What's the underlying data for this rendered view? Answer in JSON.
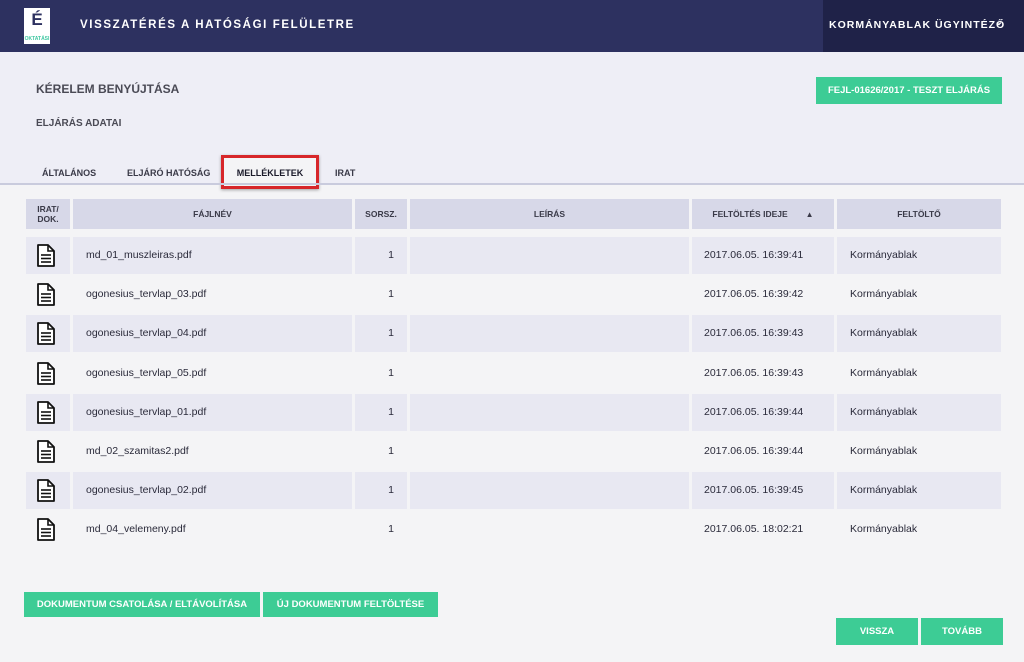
{
  "header": {
    "logo_letter": "É",
    "logo_subtext": "OKTATÁSI",
    "app_title": "VISSZATÉRÉS A HATÓSÁGI FELÜLETRE",
    "user_label": "KORMÁNYABLAK ÜGYINTÉZŐ",
    "user_chevron": "⌄"
  },
  "page": {
    "title": "KÉRELEM BENYÚJTÁSA",
    "subtitle": "ELJÁRÁS ADATAI",
    "case_button": "FEJL-01626/2017 - TESZT ELJÁRÁS"
  },
  "tabs": [
    {
      "label": "ÁLTALÁNOS",
      "active": false
    },
    {
      "label": "ELJÁRÓ HATÓSÁG",
      "active": false
    },
    {
      "label": "MELLÉKLETEK",
      "active": true
    },
    {
      "label": "IRAT",
      "active": false
    }
  ],
  "table": {
    "columns": [
      "IRAT/ DOK.",
      "FÁJLNÉV",
      "SORSZ.",
      "LEÍRÁS",
      "FELTÖLTÉS IDEJE",
      "FELTÖLTŐ"
    ],
    "sort_indicator": "▲",
    "rows": [
      {
        "icon": "document-icon",
        "filename": "md_01_muszleiras.pdf",
        "num": "1",
        "desc": "",
        "time": "2017.06.05. 16:39:41",
        "uploader": "Kormányablak"
      },
      {
        "icon": "document-icon",
        "filename": "ogonesius_tervlap_03.pdf",
        "num": "1",
        "desc": "",
        "time": "2017.06.05. 16:39:42",
        "uploader": "Kormányablak"
      },
      {
        "icon": "document-icon",
        "filename": "ogonesius_tervlap_04.pdf",
        "num": "1",
        "desc": "",
        "time": "2017.06.05. 16:39:43",
        "uploader": "Kormányablak"
      },
      {
        "icon": "document-icon",
        "filename": "ogonesius_tervlap_05.pdf",
        "num": "1",
        "desc": "",
        "time": "2017.06.05. 16:39:43",
        "uploader": "Kormányablak"
      },
      {
        "icon": "document-icon",
        "filename": "ogonesius_tervlap_01.pdf",
        "num": "1",
        "desc": "",
        "time": "2017.06.05. 16:39:44",
        "uploader": "Kormányablak"
      },
      {
        "icon": "document-icon",
        "filename": "md_02_szamitas2.pdf",
        "num": "1",
        "desc": "",
        "time": "2017.06.05. 16:39:44",
        "uploader": "Kormányablak"
      },
      {
        "icon": "document-icon",
        "filename": "ogonesius_tervlap_02.pdf",
        "num": "1",
        "desc": "",
        "time": "2017.06.05. 16:39:45",
        "uploader": "Kormányablak"
      },
      {
        "icon": "document-icon",
        "filename": "md_04_velemeny.pdf",
        "num": "1",
        "desc": "",
        "time": "2017.06.05. 18:02:21",
        "uploader": "Kormányablak"
      }
    ]
  },
  "actions": {
    "attach_button": "DOKUMENTUM CSATOLÁSA / ELTÁVOLÍTÁSA",
    "upload_button": "ÚJ DOKUMENTUM FELTÖLTÉSE",
    "back_button": "VISSZA",
    "next_button": "TOVÁBB"
  },
  "colors": {
    "header_bg": "#2d3160",
    "user_box_bg": "#1f2248",
    "accent_green": "#3dcc95",
    "highlight_red": "#d7262a"
  }
}
